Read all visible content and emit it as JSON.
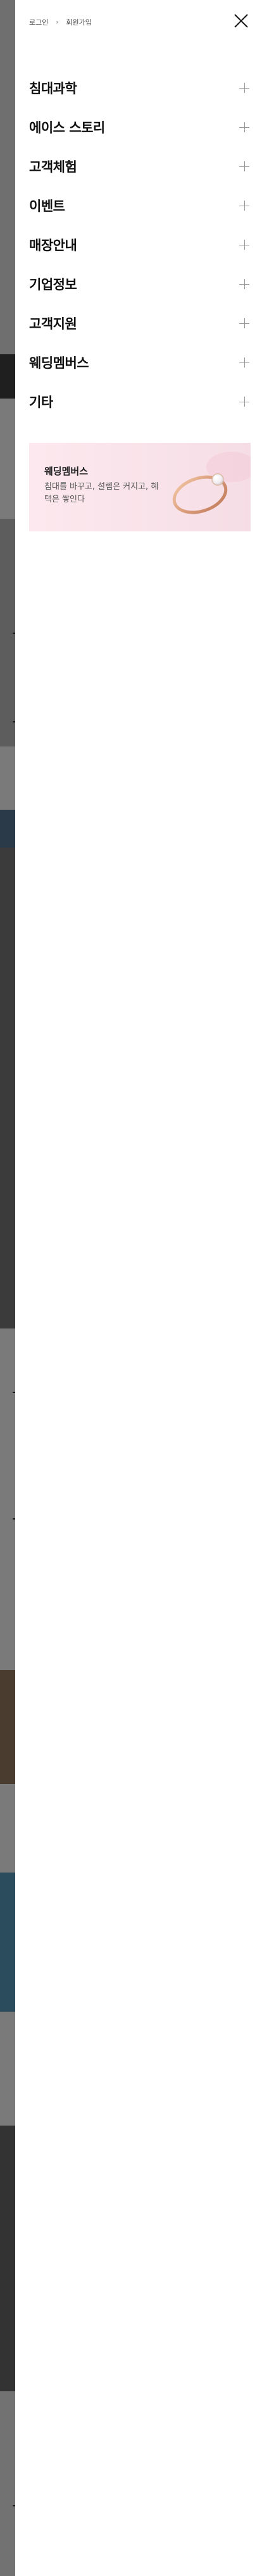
{
  "header": {
    "login_label": "로그인",
    "separator": "›",
    "signup_label": "회원가입",
    "close_icon": "close-icon"
  },
  "menu": {
    "items": [
      {
        "label": "침대과학",
        "icon": "plus-icon"
      },
      {
        "label": "에이스 스토리",
        "icon": "plus-icon"
      },
      {
        "label": "고객체험",
        "icon": "plus-icon"
      },
      {
        "label": "이벤트",
        "icon": "plus-icon"
      },
      {
        "label": "매장안내",
        "icon": "plus-icon"
      },
      {
        "label": "기업정보",
        "icon": "plus-icon"
      },
      {
        "label": "고객지원",
        "icon": "plus-icon"
      },
      {
        "label": "웨딩멤버스",
        "icon": "plus-icon"
      },
      {
        "label": "기타",
        "icon": "plus-icon"
      }
    ]
  },
  "banner": {
    "title": "웨딩멤버스",
    "description": "침대를 바꾸고, 설렘은 커지고, 혜택은 쌓인다",
    "image_icon": "ring-icon",
    "colors": {
      "background": "#fce8ee"
    }
  }
}
